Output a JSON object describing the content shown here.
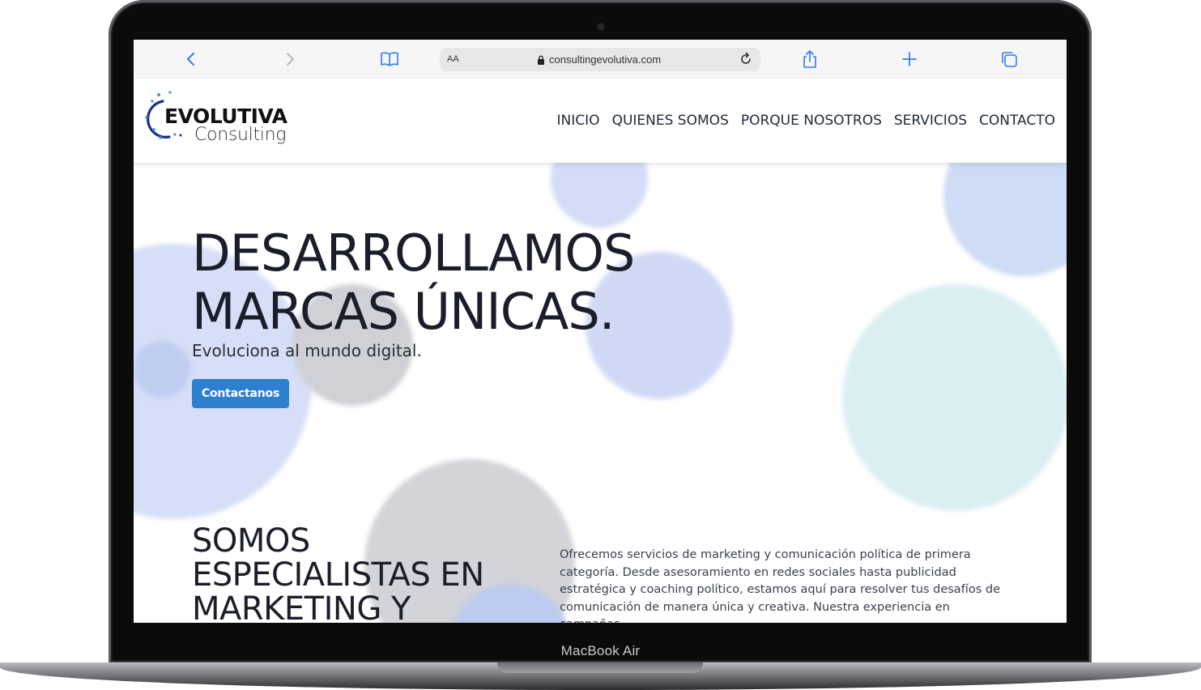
{
  "device": {
    "label": "MacBook Air"
  },
  "browser": {
    "text_size_label": "AA",
    "url": "consultingevolutiva.com"
  },
  "site": {
    "logo": {
      "title": "EVOLUTIVA",
      "subtitle": "Consulting"
    },
    "nav": [
      "INICIO",
      "QUIENES SOMOS",
      "PORQUE NOSOTROS",
      "SERVICIOS",
      "CONTACTO"
    ],
    "hero": {
      "title_line1": "DESARROLLAMOS",
      "title_line2": "MARCAS ÚNICAS.",
      "subtitle": "Evoluciona al mundo digital.",
      "cta_label": "Contactanos"
    },
    "section": {
      "title_line1": "SOMOS",
      "title_line2": "ESPECIALISTAS EN",
      "title_line3": "MARKETING Y",
      "body": "Ofrecemos servicios de marketing y comunicación política de primera categoría. Desde asesoramiento en redes sociales hasta publicidad estratégica y coaching político, estamos aquí para resolver tus desafíos de comunicación de manera única y creativa. Nuestra experiencia en campañas"
    }
  },
  "colors": {
    "accent": "#2f7fcf",
    "browser_accent": "#2f7cf6",
    "heading": "#1b1e2a"
  }
}
